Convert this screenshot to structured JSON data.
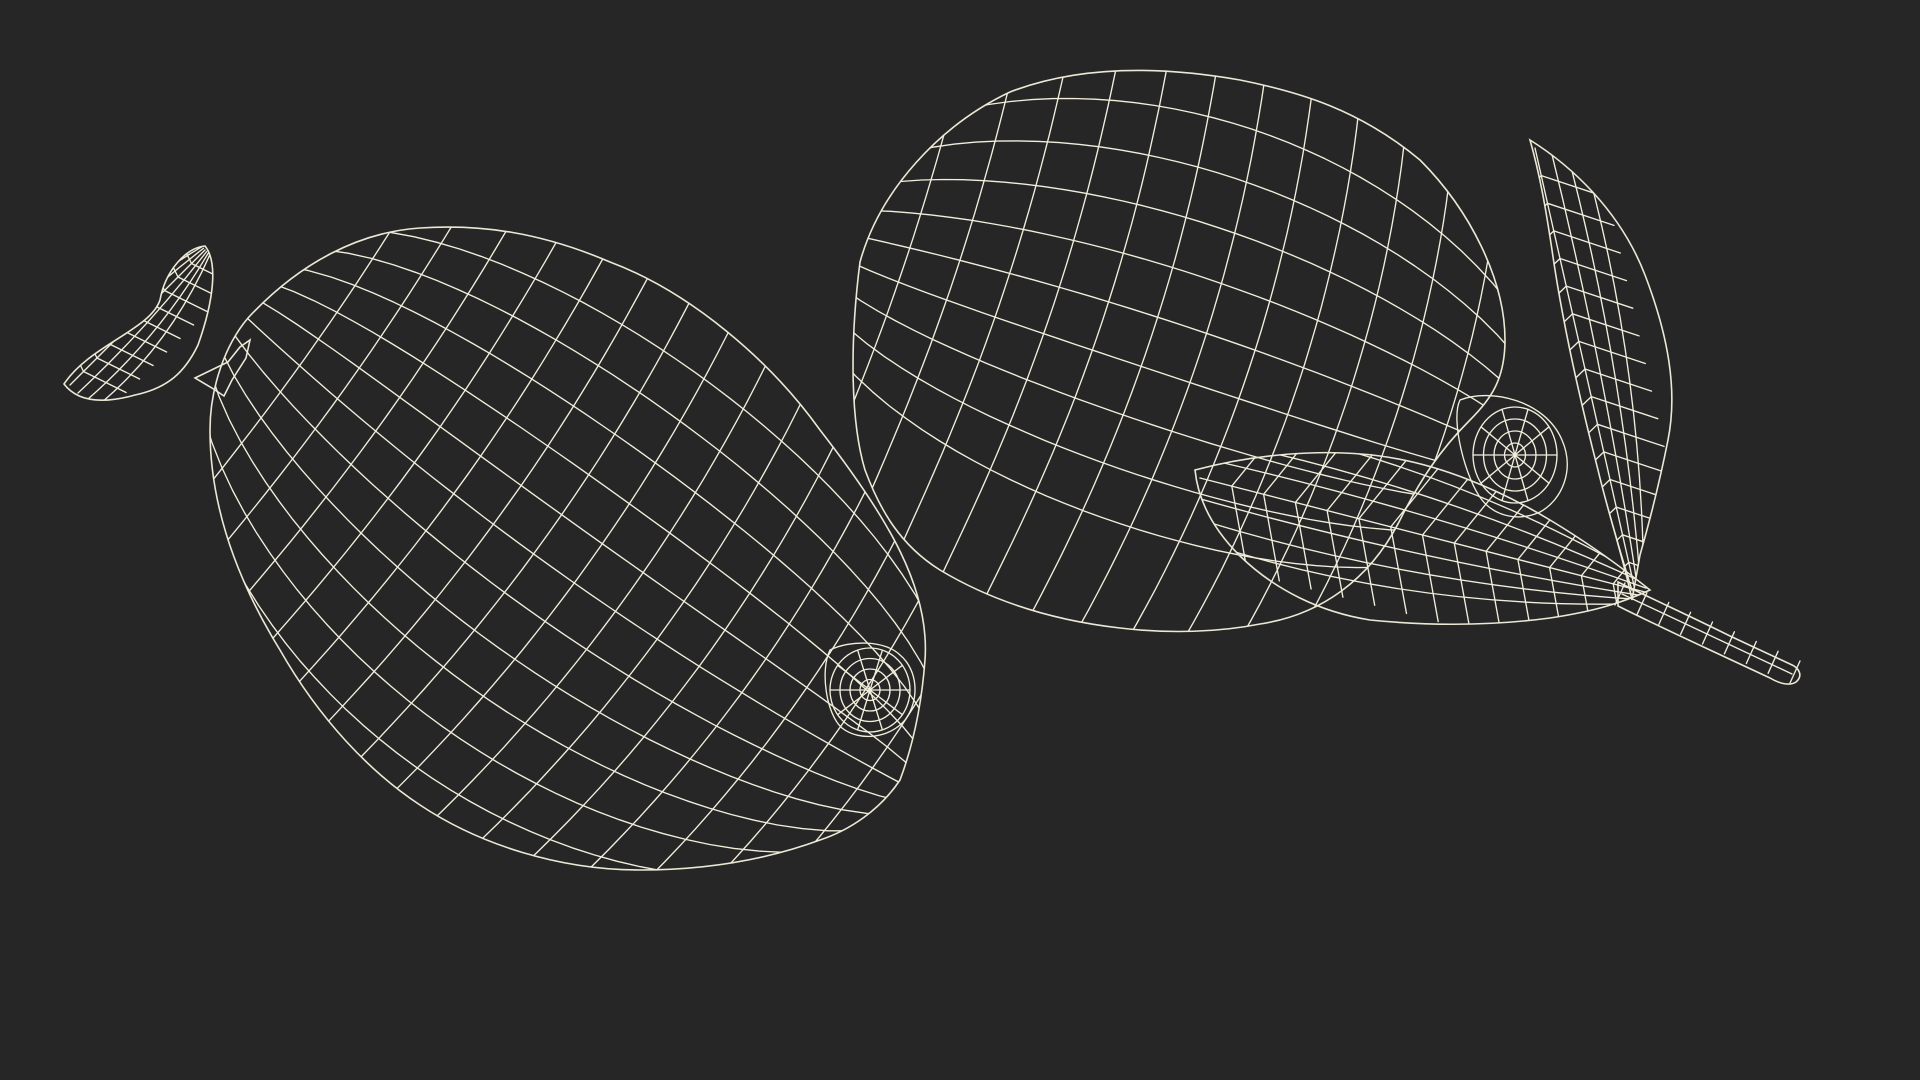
{
  "scene": {
    "background_color": "#262626",
    "mesh_fill_color": "#7b7d72",
    "mesh_shadow_color": "#55574f",
    "wire_color": "#f2eedc",
    "objects": [
      {
        "name": "lemon-left",
        "kind": "lemon",
        "parts": [
          "body",
          "tip",
          "stem",
          "leaf"
        ]
      },
      {
        "name": "lemon-right",
        "kind": "lemon",
        "parts": [
          "body",
          "tip",
          "leaf-lower",
          "leaf-upper",
          "branch-stem"
        ]
      }
    ]
  }
}
